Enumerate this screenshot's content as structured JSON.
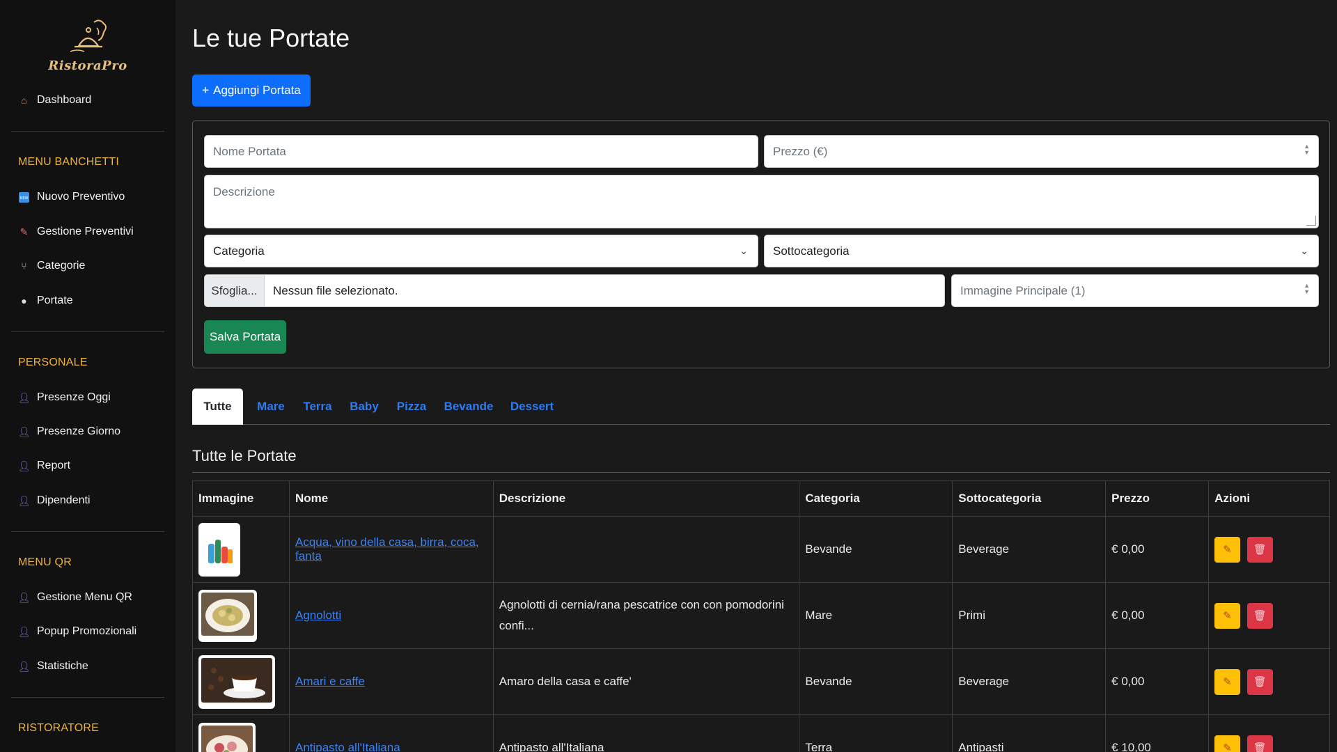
{
  "sidebar": {
    "logo_text": "RistoraPro",
    "dashboard": "Dashboard",
    "sections": [
      {
        "title": "MENU BANCHETTI",
        "items": [
          "Nuovo Preventivo",
          "Gestione Preventivi",
          "Categorie",
          "Portate"
        ]
      },
      {
        "title": "PERSONALE",
        "items": [
          "Presenze Oggi",
          "Presenze Giorno",
          "Report",
          "Dipendenti"
        ]
      },
      {
        "title": "MENU QR",
        "items": [
          "Gestione Menu QR",
          "Popup Promozionali",
          "Statistiche"
        ]
      },
      {
        "title": "RISTORATORE",
        "items": []
      }
    ]
  },
  "page": {
    "title": "Le tue Portate",
    "add_button": "Aggiungi Portata"
  },
  "form": {
    "name_placeholder": "Nome Portata",
    "price_placeholder": "Prezzo (€)",
    "description_placeholder": "Descrizione",
    "category_select": "Categoria",
    "subcategory_select": "Sottocategoria",
    "file_button": "Sfoglia...",
    "file_label": "Nessun file selezionato.",
    "main_image_placeholder": "Immagine Principale (1)",
    "save_button": "Salva Portata"
  },
  "tabs": [
    "Tutte",
    "Mare",
    "Terra",
    "Baby",
    "Pizza",
    "Bevande",
    "Dessert"
  ],
  "table": {
    "subtitle": "Tutte le Portate",
    "headers": [
      "Immagine",
      "Nome",
      "Descrizione",
      "Categoria",
      "Sottocategoria",
      "Prezzo",
      "Azioni"
    ],
    "rows": [
      {
        "name": "Acqua, vino della casa, birra, coca, fanta",
        "description": "",
        "category": "Bevande",
        "subcategory": "Beverage",
        "price": "€ 0,00"
      },
      {
        "name": "Agnolotti",
        "description": "Agnolotti di cernia/rana pescatrice con con pomodorini confi...",
        "category": "Mare",
        "subcategory": "Primi",
        "price": "€ 0,00"
      },
      {
        "name": "Amari e caffe",
        "description": "Amaro della casa e caffe'",
        "category": "Bevande",
        "subcategory": "Beverage",
        "price": "€ 0,00"
      },
      {
        "name": "Antipasto all'Italiana",
        "description": "Antipasto all'Italiana",
        "category": "Terra",
        "subcategory": "Antipasti",
        "price": "€ 10,00"
      }
    ]
  },
  "colors": {
    "accent_blue": "#0d6efd",
    "success_green": "#198754",
    "section_orange": "#f0b33a",
    "edit_yellow": "#ffc107",
    "delete_red": "#dc3545"
  }
}
